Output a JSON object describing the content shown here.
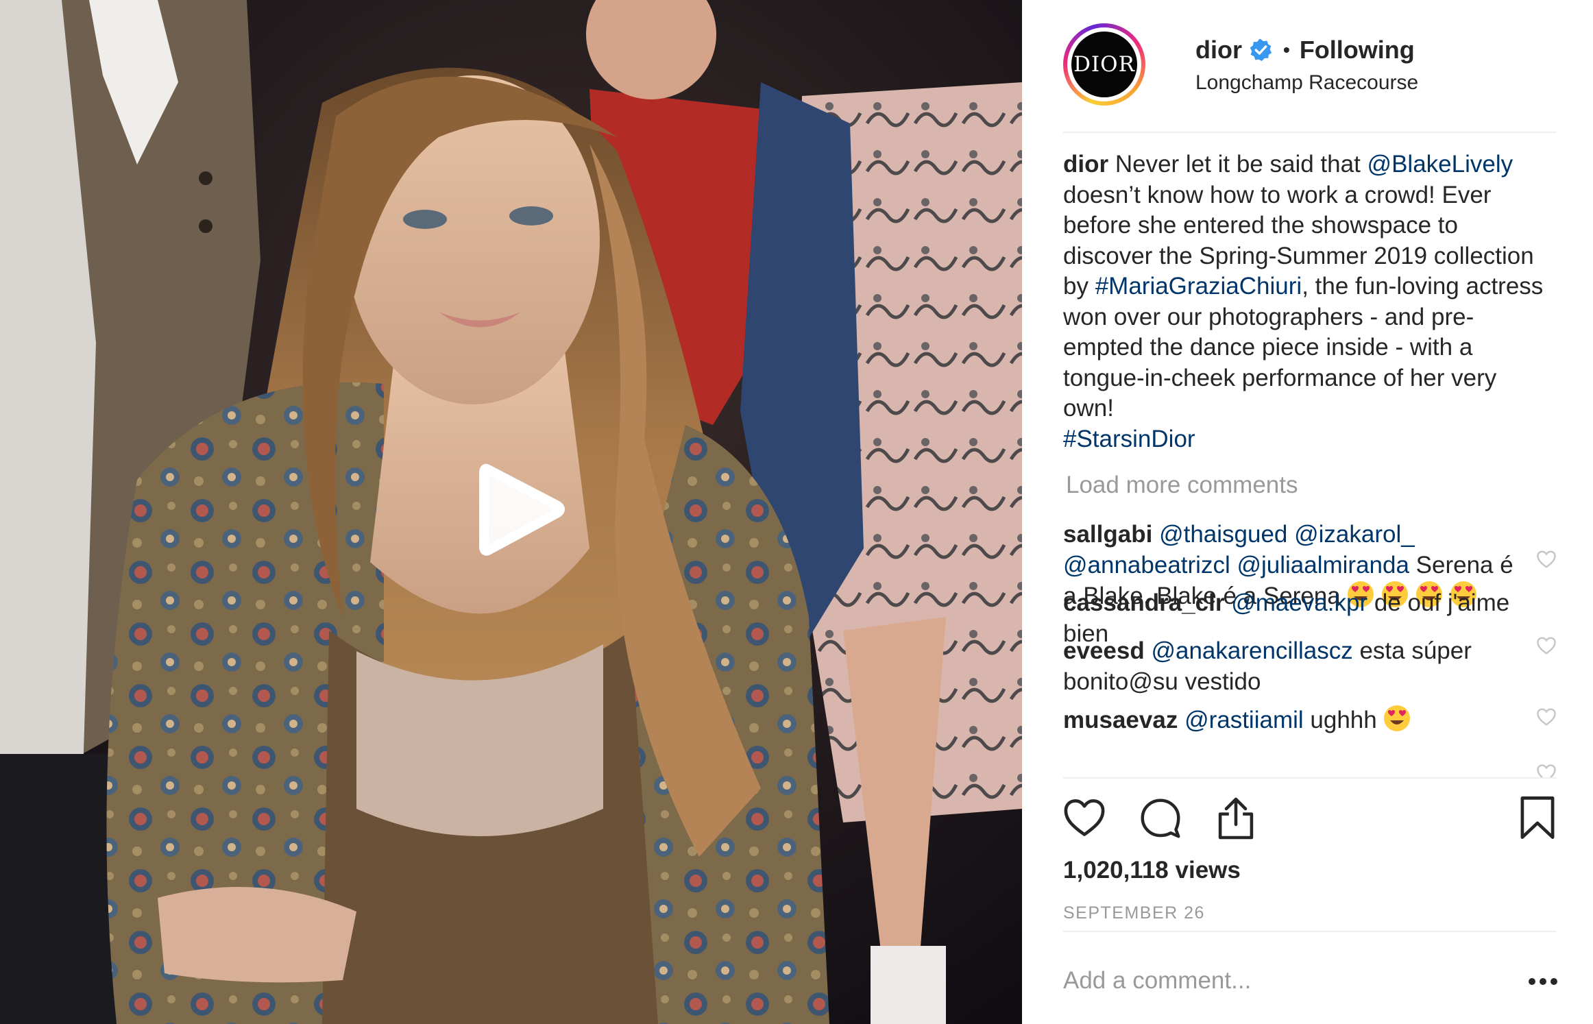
{
  "post": {
    "author": "dior",
    "avatar_text": "DIOR",
    "follow_state": "Following",
    "separator": "•",
    "location": "Longchamp Racecourse",
    "verified": true
  },
  "caption": {
    "author": "dior",
    "lines": [
      {
        "pre": "Never let it be said that ",
        "mention": "@BlakeLively"
      },
      {
        "text": "doesn’t know how to work a crowd! Ever"
      },
      {
        "text": "before she entered the showspace to"
      },
      {
        "text": "discover the Spring-Summer 2019 collection"
      },
      {
        "pre": "by ",
        "mention": "#MariaGraziaChiuri",
        "post": ", the fun-loving actress"
      },
      {
        "text": "won over our photographers - and pre-"
      },
      {
        "text": "empted the dance piece inside - with a"
      },
      {
        "text": "tongue-in-cheek performance of her very"
      },
      {
        "text": "own!"
      }
    ],
    "hashtag": "#StarsinDior"
  },
  "load_more_label": "Load more comments",
  "comments": [
    {
      "user": "sallgabi",
      "lines": [
        {
          "mentions": [
            "@thaisgued",
            "@izakarol_"
          ]
        },
        {
          "mentions": [
            "@annabeatrizcl",
            "@juliaalmiranda"
          ],
          "post": " Serena é"
        },
        {
          "text": "a Blake, Blake é a Serena"
        }
      ],
      "emoji_count": 4
    },
    {
      "user": "cassandra_clr",
      "lines": [
        {
          "mentions": [
            "@maeva.kpr"
          ],
          "post": " de ouf j'aime"
        },
        {
          "text": "bien"
        }
      ]
    },
    {
      "user": "eveesd",
      "lines": [
        {
          "mentions": [
            "@anakarencillascz"
          ],
          "post": " esta súper"
        },
        {
          "text": "bonito@su vestido"
        }
      ]
    },
    {
      "user": "musaevaz",
      "lines": [
        {
          "mentions": [
            "@rastiiamil"
          ],
          "post": " ughhh"
        }
      ],
      "emoji_count": 1
    }
  ],
  "stats": {
    "views": "1,020,118 views",
    "date": "SEPTEMBER 26"
  },
  "composer": {
    "placeholder": "Add a comment..."
  },
  "icons": {
    "like": "heart-outline-icon",
    "comment": "speech-bubble-icon",
    "share": "share-upload-icon",
    "save": "bookmark-icon",
    "more": "ellipsis-icon",
    "play": "play-icon",
    "verified": "verified-badge-icon"
  },
  "colors": {
    "text": "#262626",
    "link": "#003569",
    "muted": "#999999",
    "verified": "#3897f0",
    "divider": "#efefef"
  }
}
